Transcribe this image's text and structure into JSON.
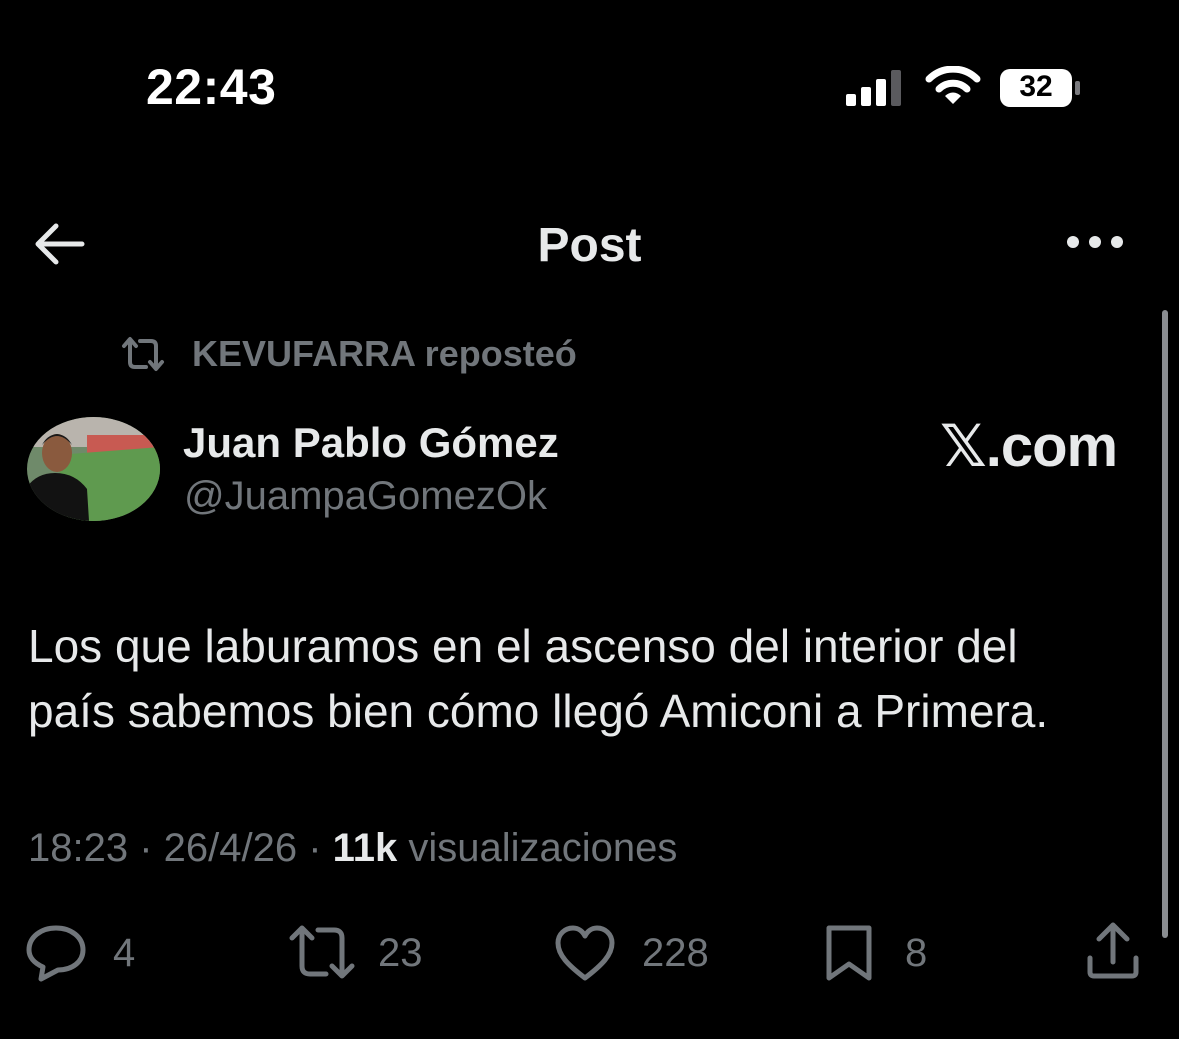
{
  "status_bar": {
    "time": "22:43",
    "battery": "32"
  },
  "nav": {
    "title": "Post"
  },
  "repost": {
    "text": "KEVUFARRA reposteó"
  },
  "author": {
    "name": "Juan Pablo Gómez",
    "handle": "@JuampaGomezOk",
    "source": "𝕏.com"
  },
  "post": {
    "line1": "Los que laburamos en el ascenso del interior del",
    "line2": "país sabemos bien cómo llegó Amiconi a Primera."
  },
  "meta": {
    "time": "18:23",
    "date": "26/4/26",
    "views_count": "11k",
    "views_label": "visualizaciones",
    "sep": " · "
  },
  "actions": {
    "replies": "4",
    "reposts": "23",
    "likes": "228",
    "bookmarks": "8"
  }
}
